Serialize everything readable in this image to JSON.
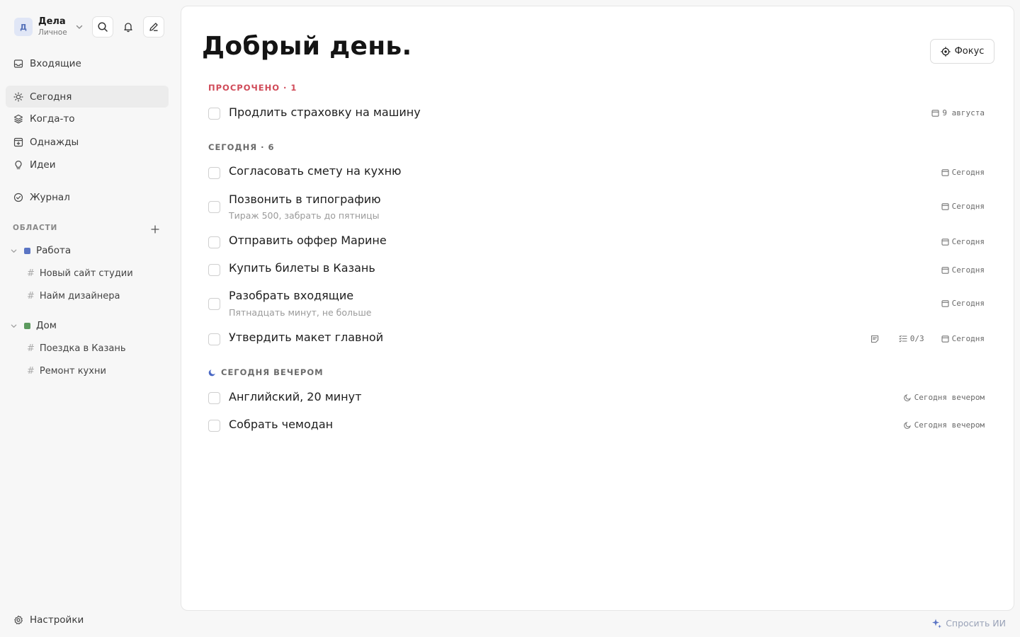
{
  "workspace": {
    "avatar_letter": "Д",
    "name": "Дела",
    "subtitle": "Личное"
  },
  "sidebar": {
    "nav": [
      {
        "label": "Входящие",
        "icon": "inbox-icon"
      },
      {
        "label": "Сегодня",
        "icon": "sun-icon",
        "active": true
      },
      {
        "label": "Когда-то",
        "icon": "layers-icon"
      },
      {
        "label": "Однажды",
        "icon": "archive-icon"
      },
      {
        "label": "Идеи",
        "icon": "lightbulb-icon"
      },
      {
        "label": "Журнал",
        "icon": "check-circle-icon"
      }
    ],
    "areas_heading": "ОБЛАСТИ",
    "areas": [
      {
        "name": "Работа",
        "color": "#5b75c4",
        "projects": [
          "Новый сайт студии",
          "Найм дизайнера"
        ]
      },
      {
        "name": "Дом",
        "color": "#5c9a5e",
        "projects": [
          "Поездка в Казань",
          "Ремонт кухни"
        ]
      }
    ],
    "settings_label": "Настройки"
  },
  "main": {
    "greeting": "Добрый день.",
    "focus_button": "Фокус",
    "sections": {
      "overdue": {
        "heading": "ПРОСРОЧЕНО · 1",
        "tasks": [
          {
            "title": "Продлить страховку на машину",
            "date": "9 августа"
          }
        ]
      },
      "today": {
        "heading": "СЕГОДНЯ · 6",
        "tasks": [
          {
            "title": "Согласовать смету на кухню",
            "date": "Сегодня"
          },
          {
            "title": "Позвонить в типографию",
            "note": "Тираж 500, забрать до пятницы",
            "date": "Сегодня"
          },
          {
            "title": "Отправить оффер Марине",
            "date": "Сегодня"
          },
          {
            "title": "Купить билеты в Казань",
            "date": "Сегодня"
          },
          {
            "title": "Разобрать входящие",
            "note": "Пятнадцать минут, не больше",
            "date": "Сегодня"
          },
          {
            "title": "Утвердить макет главной",
            "checklist": "0/3",
            "date": "Сегодня",
            "has_notes": true
          }
        ]
      },
      "evening": {
        "heading": "СЕГОДНЯ ВЕЧЕРОМ",
        "tasks": [
          {
            "title": "Английский, 20 минут",
            "date": "Сегодня вечером"
          },
          {
            "title": "Собрать чемодан",
            "date": "Сегодня вечером"
          }
        ]
      }
    }
  },
  "ask_ai": "Спросить ИИ",
  "colors": {
    "overdue": "#d04a58",
    "accent": "#5b75c4"
  }
}
